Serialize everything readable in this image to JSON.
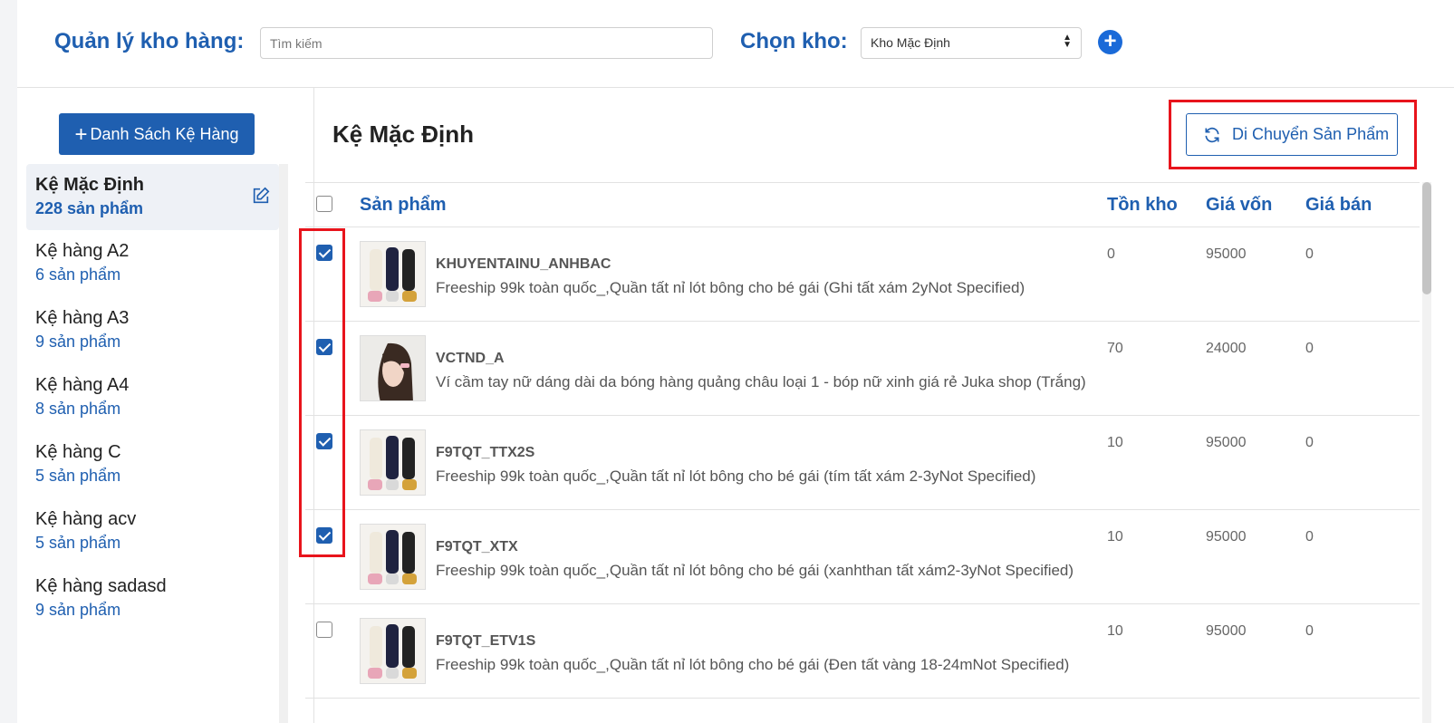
{
  "header": {
    "title": "Quản lý kho hàng:",
    "search_placeholder": "Tìm kiếm",
    "warehouse_label": "Chọn kho:",
    "warehouse_selected": "Kho Mặc Định"
  },
  "sidebar": {
    "list_button": "Danh Sách Kệ Hàng",
    "shelves": [
      {
        "name": "Kệ Mặc Định",
        "count": "228 sản phẩm"
      },
      {
        "name": "Kệ hàng A2",
        "count": "6 sản phẩm"
      },
      {
        "name": "Kệ hàng A3",
        "count": "9 sản phẩm"
      },
      {
        "name": "Kệ hàng A4",
        "count": "8 sản phẩm"
      },
      {
        "name": "Kệ hàng C",
        "count": "5 sản phẩm"
      },
      {
        "name": "Kệ hàng acv",
        "count": "5 sản phẩm"
      },
      {
        "name": "Kệ hàng sadasd",
        "count": "9 sản phẩm"
      }
    ]
  },
  "main": {
    "title": "Kệ Mặc Định",
    "move_button": "Di Chuyển Sản Phẩm",
    "columns": {
      "product": "Sản phẩm",
      "stock": "Tồn kho",
      "cost": "Giá vốn",
      "price": "Giá bán"
    },
    "rows": [
      {
        "checked": true,
        "sku": "KHUYENTAINU_ANHBAC",
        "name": "Freeship 99k toàn quốc_,Quần tất nỉ lót bông cho bé gái (Ghi tất xám 2yNot Specified)",
        "stock": "0",
        "cost": "95000",
        "price": "0"
      },
      {
        "checked": true,
        "sku": "VCTND_A",
        "name": "Ví cầm tay nữ dáng dài da bóng hàng quảng châu loại 1 - bóp nữ xinh giá rẻ Juka shop (Trắng)",
        "stock": "70",
        "cost": "24000",
        "price": "0"
      },
      {
        "checked": true,
        "sku": "F9TQT_TTX2S",
        "name": "Freeship 99k toàn quốc_,Quần tất nỉ lót bông cho bé gái (tím tất xám 2-3yNot Specified)",
        "stock": "10",
        "cost": "95000",
        "price": "0"
      },
      {
        "checked": true,
        "sku": "F9TQT_XTX",
        "name": "Freeship 99k toàn quốc_,Quần tất nỉ lót bông cho bé gái (xanhthan tất xám2-3yNot Specified)",
        "stock": "10",
        "cost": "95000",
        "price": "0"
      },
      {
        "checked": false,
        "sku": "F9TQT_ETV1S",
        "name": "Freeship 99k toàn quốc_,Quần tất nỉ lót bông cho bé gái (Đen tất vàng 18-24mNot Specified)",
        "stock": "10",
        "cost": "95000",
        "price": "0"
      }
    ]
  },
  "colors": {
    "accent": "#1f5fb0",
    "highlight": "#e8141c"
  }
}
